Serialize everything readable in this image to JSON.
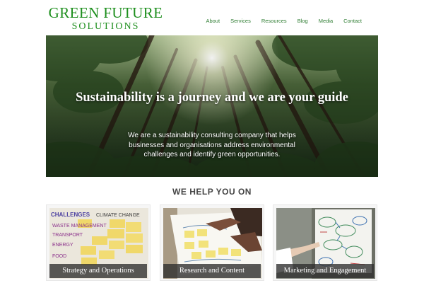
{
  "logo": {
    "line1": "GREEN FUTURE",
    "line2": "SOLUTIONS"
  },
  "nav": [
    "About",
    "Services",
    "Resources",
    "Blog",
    "Media",
    "Contact"
  ],
  "hero": {
    "title": "Sustainability is a journey and we are your guide",
    "description": "We are a sustainability consulting company that helps businesses and organisations address environmental challenges and identify green opportunities."
  },
  "section_heading": "WE HELP YOU ON",
  "cards": [
    {
      "title": "Strategy and Operations",
      "note_title": "CHALLENGES",
      "note_subtitle": "CLIMATE CHANGE",
      "note_items": [
        "WASTE MANAGEMENT",
        "TRANSPORT",
        "ENERGY",
        "FOOD"
      ]
    },
    {
      "title": "Research and Content"
    },
    {
      "title": "Marketing and Engagement"
    }
  ],
  "colors": {
    "brand_green": "#1e8f1e",
    "nav_green": "#2e7d32",
    "caption_bg": "#2d2d2d",
    "heading_gray": "#444444"
  }
}
